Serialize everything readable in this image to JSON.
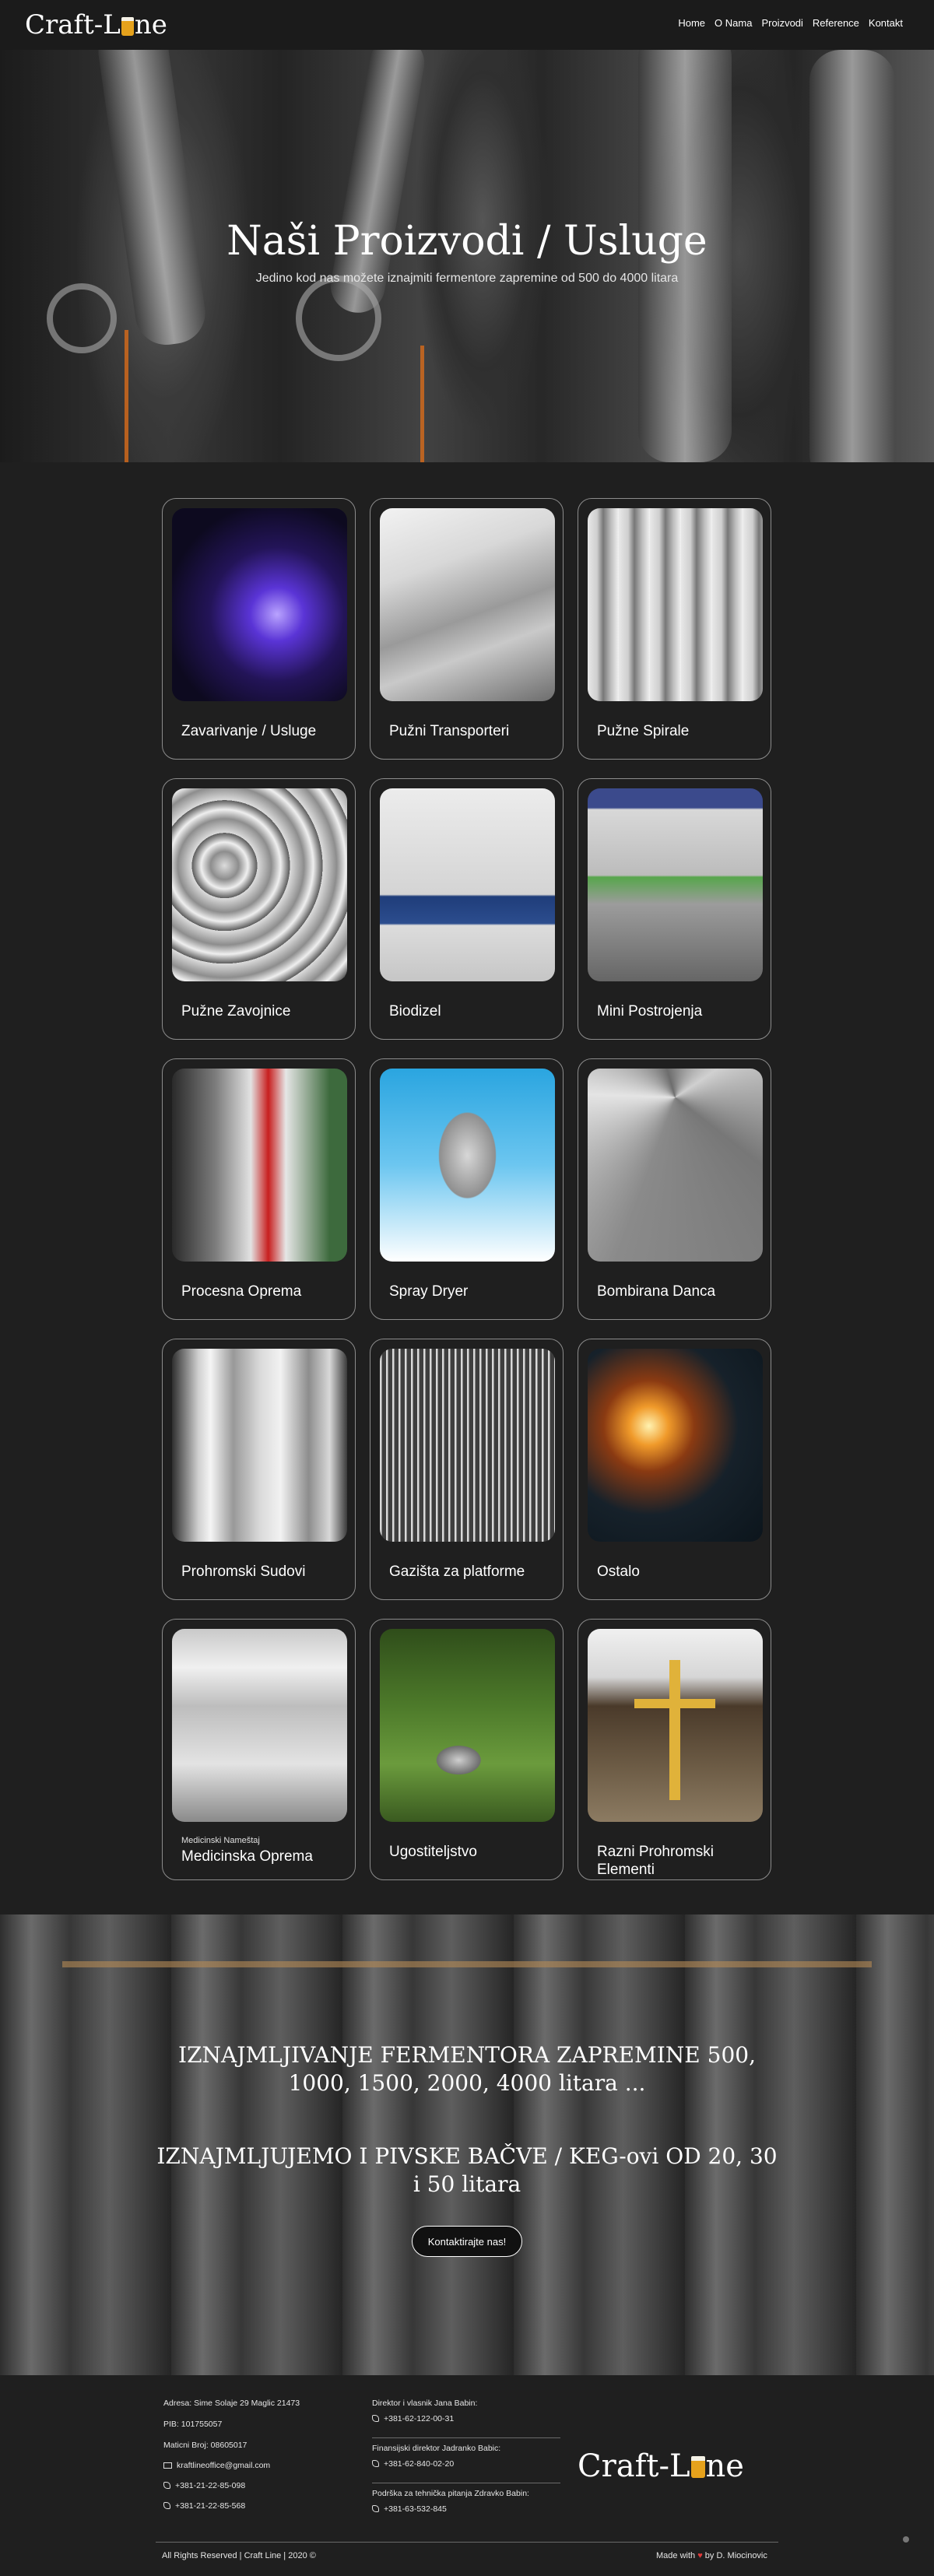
{
  "header": {
    "logo": "Craft-Line",
    "menu": [
      "Home",
      "O Nama",
      "Proizvodi",
      "Reference",
      "Kontakt"
    ]
  },
  "hero": {
    "title": "Naši Proizvodi / Usluge",
    "subtitle": "Jedino kod nas možete iznajmiti fermentore zapremine od 500 do 4000 litara"
  },
  "products": [
    {
      "title": "Zavarivanje / Usluge",
      "image": "welding-blue-light"
    },
    {
      "title": "Pužni Transporteri",
      "image": "screw-conveyor"
    },
    {
      "title": "Pužne Spirale",
      "image": "screw-spirals"
    },
    {
      "title": "Pužne Zavojnice",
      "image": "screw-flights"
    },
    {
      "title": "Biodizel",
      "image": "biodiesel-plant"
    },
    {
      "title": "Mini Postrojenja",
      "image": "mini-plant"
    },
    {
      "title": "Procesna Oprema",
      "image": "process-equipment"
    },
    {
      "title": "Spray Dryer",
      "image": "spray-dryer"
    },
    {
      "title": "Bombirana Danca",
      "image": "dished-heads"
    },
    {
      "title": "Prohromski Sudovi",
      "image": "stainless-vessels"
    },
    {
      "title": "Gazišta za platforme",
      "image": "grating-platforms"
    },
    {
      "title": "Ostalo",
      "image": "grinder-sparks"
    },
    {
      "title": "Medicinska Oprema",
      "subtitle": "Medicinski Nameštaj",
      "image": "medical-cart"
    },
    {
      "title": "Ugostiteljstvo",
      "image": "kettle-pot"
    },
    {
      "title": "Razni Prohromski Elementi",
      "image": "golden-cross"
    }
  ],
  "banner": {
    "heading1": "IZNAJMLJIVANJE FERMENTORA ZAPREMINE 500, 1000, 1500, 2000, 4000 litara ...",
    "heading2": "IZNAJMLJUJEMO I PIVSKE BAČVE / KEG-ovi OD 20, 30 i 50 litara",
    "button": "Kontaktirajte nas!"
  },
  "footer": {
    "address": "Adresa: Sime Solaje 29 Maglic 21473",
    "pib": "PIB: 101755057",
    "mb": "Maticni Broj: 08605017",
    "email": "kraftlineoffice@gmail.com",
    "phone1": "+381-21-22-85-098",
    "phone2": "+381-21-22-85-568",
    "director_label": "Direktor i vlasnik Jana Babin:",
    "director_phone": "+381-62-122-00-31",
    "finance_label": "Finansijski direktor Jadranko Babic:",
    "finance_phone": "+381-62-840-02-20",
    "tech_label": "Podrška za tehnička pitanja Zdravko Babin:",
    "tech_phone": "+381-63-532-845",
    "logo": "Craft-Line",
    "copyright": "All Rights Reserved | Craft Line | 2020 ©",
    "made_prefix": "Made with",
    "made_suffix": "by D. Miocinovic"
  },
  "colors": {
    "background": "#1f1f1f",
    "card_border": "#8c8c8c",
    "logo_accent": "#e6a21c",
    "heart": "#e03a3a"
  }
}
